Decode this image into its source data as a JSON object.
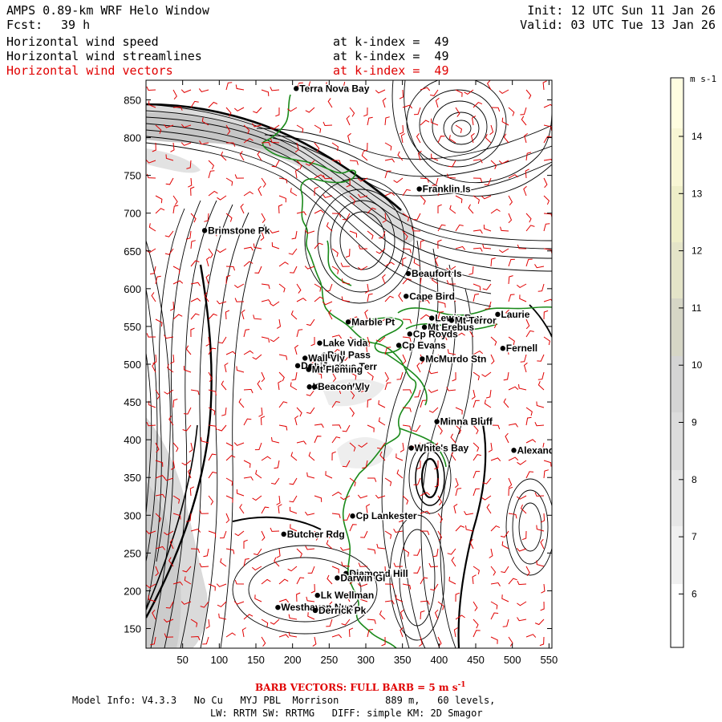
{
  "header": {
    "model_title": "AMPS 0.89-km WRF Helo Window",
    "forecast_label": "Fcst:",
    "forecast_hours": "39 h",
    "init": "Init: 12 UTC Sun 11 Jan 26",
    "valid": "Valid: 03 UTC Tue 13 Jan 26",
    "fields": [
      {
        "name": "Horizontal wind speed",
        "level": "at k-index =  49",
        "color": "#000000"
      },
      {
        "name": "Horizontal wind streamlines",
        "level": "at k-index =  49",
        "color": "#000000"
      },
      {
        "name": "Horizontal wind vectors",
        "level": "at k-index =  49",
        "color": "#e00000"
      }
    ]
  },
  "map": {
    "x_ticks": [
      "50",
      "100",
      "150",
      "200",
      "250",
      "300",
      "350",
      "400",
      "450",
      "500",
      "550"
    ],
    "y_ticks": [
      "850",
      "800",
      "750",
      "700",
      "650",
      "600",
      "550",
      "500",
      "450",
      "400",
      "350",
      "300",
      "250",
      "200",
      "150"
    ],
    "coast_color": "#1a8a1a",
    "barb_color": "#e00000",
    "places": [
      {
        "name": "Terra Nova Bay",
        "x": 205,
        "y": 865
      },
      {
        "name": "Franklin Is",
        "x": 373,
        "y": 732
      },
      {
        "name": "Brimstone Pk",
        "x": 80,
        "y": 677
      },
      {
        "name": "Beaufort Is",
        "x": 358,
        "y": 620
      },
      {
        "name": "Cape Bird",
        "x": 355,
        "y": 590
      },
      {
        "name": "Lewis Bay",
        "x": 390,
        "y": 561
      },
      {
        "name": "Laurie",
        "x": 480,
        "y": 566
      },
      {
        "name": "Mt Terror",
        "x": 417,
        "y": 558
      },
      {
        "name": "Marble Pt",
        "x": 276,
        "y": 556
      },
      {
        "name": "Mt Erebus",
        "x": 380,
        "y": 549
      },
      {
        "name": "Cp Royds",
        "x": 360,
        "y": 540
      },
      {
        "name": "Lake Vida",
        "x": 237,
        "y": 528
      },
      {
        "name": "Cp Evans",
        "x": 345,
        "y": 525
      },
      {
        "name": "Fernell",
        "x": 487,
        "y": 521
      },
      {
        "name": "Bull Pass",
        "x": 243,
        "y": 512
      },
      {
        "name": "Wall Vly",
        "x": 217,
        "y": 508
      },
      {
        "name": "McMurdo Stn",
        "x": 377,
        "y": 507
      },
      {
        "name": "Don Juan",
        "x": 207,
        "y": 498
      },
      {
        "name": "Linnaeus Terr",
        "x": 225,
        "y": 497
      },
      {
        "name": "Mt Fleming",
        "x": 222,
        "y": 493
      },
      {
        "name": "Kennar Vly",
        "x": 223,
        "y": 470
      },
      {
        "name": "Beacon Vly",
        "x": 230,
        "y": 470
      },
      {
        "name": "Minna Bluff",
        "x": 397,
        "y": 424
      },
      {
        "name": "White's Bay",
        "x": 362,
        "y": 389
      },
      {
        "name": "Alexander",
        "x": 502,
        "y": 386
      },
      {
        "name": "Cp Lankester",
        "x": 282,
        "y": 299
      },
      {
        "name": "Butcher Rdg",
        "x": 188,
        "y": 275
      },
      {
        "name": "Diamond Hill",
        "x": 273,
        "y": 223
      },
      {
        "name": "Darwin Gl",
        "x": 261,
        "y": 217
      },
      {
        "name": "Lk Wellman",
        "x": 234,
        "y": 194
      },
      {
        "name": "Westhaven Nun",
        "x": 180,
        "y": 178
      },
      {
        "name": "Derrick Pk",
        "x": 231,
        "y": 174
      }
    ]
  },
  "colorbar": {
    "unit": "m s-1",
    "labels": [
      "14",
      "13",
      "12",
      "11",
      "10",
      "9",
      "8",
      "7",
      "6"
    ]
  },
  "footer": {
    "barb_note": "BARB VECTORS:  FULL BARB = 5 m s",
    "barb_unit_exp": "-1",
    "model_info": "Model Info: V4.3.3   No Cu   MYJ PBL  Morrison        889 m,   60 levels,",
    "model_info2": "LW: RRTM SW: RRTMG   DIFF: simple KM: 2D Smagor"
  }
}
